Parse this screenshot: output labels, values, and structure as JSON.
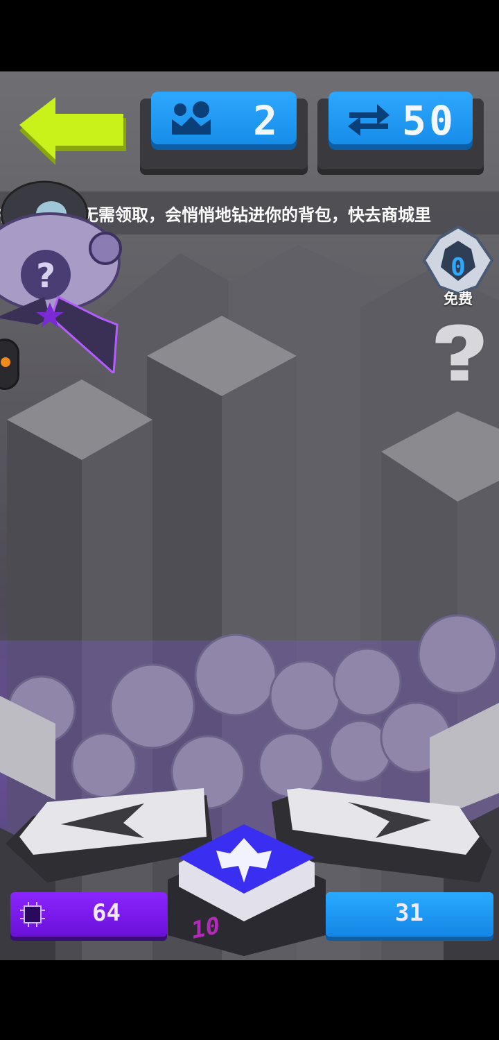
{
  "topbar": {
    "back_icon": "arrow-left-icon",
    "levels_icon": "map-icon",
    "levels_value": "2",
    "swaps_icon": "swap-arrows-icon",
    "swaps_value": "50"
  },
  "ticker": {
    "text": "行榜奖励则无需领取，会悄悄地钻进你的背包，快去商城里"
  },
  "side_buttons": {
    "free_value": "0",
    "free_label": "免费",
    "help_icon": "question-icon"
  },
  "controls": {
    "left_icon": "chevron-left-icon",
    "right_icon": "chevron-right-icon",
    "center_icon": "spaceship-icon",
    "center_value": "10"
  },
  "stats": {
    "left_icon": "chip-icon",
    "left_value": "64",
    "right_value": "31"
  },
  "colors": {
    "accent_blue": "#2ea7ff",
    "accent_purple": "#8a25ff",
    "back_green": "#c8f21a"
  }
}
